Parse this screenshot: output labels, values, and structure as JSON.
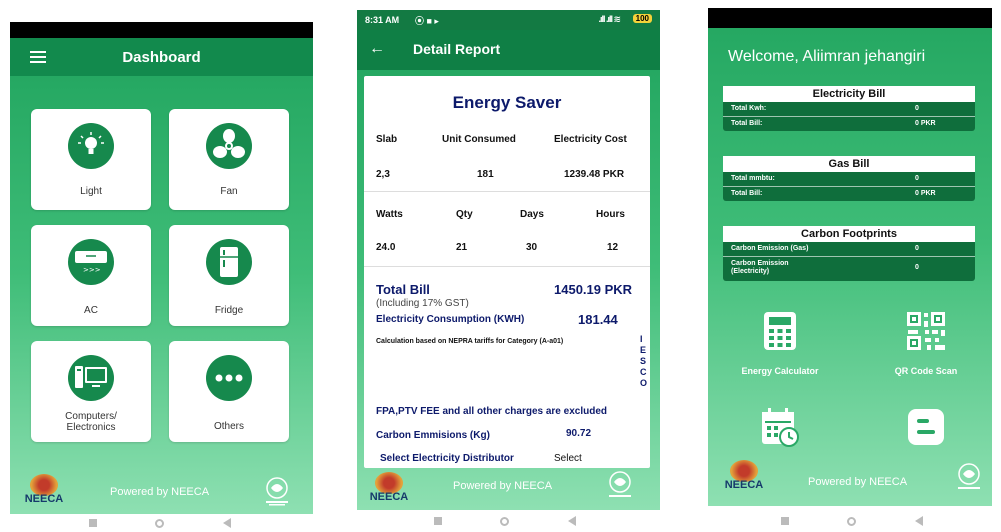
{
  "dashboard": {
    "title": "Dashboard",
    "cards": [
      {
        "label": "Light",
        "icon": "lightbulb-icon"
      },
      {
        "label": "Fan",
        "icon": "fan-icon"
      },
      {
        "label": "AC",
        "icon": "ac-icon"
      },
      {
        "label": "Fridge",
        "icon": "fridge-icon"
      },
      {
        "label": "Computers/\nElectronics",
        "icon": "computer-icon"
      },
      {
        "label": "Others",
        "icon": "more-dots-icon"
      }
    ],
    "footer": {
      "logo_text": "NEECA",
      "powered_prefix": "Powered by ",
      "powered_brand": "NEECA"
    }
  },
  "report": {
    "status_time": "8:31 AM",
    "battery": "100",
    "app_title": "Detail Report",
    "heading": "Energy Saver",
    "h1": {
      "slab": "Slab",
      "unit": "Unit Consumed",
      "cost": "Electricity Cost"
    },
    "v1": {
      "slab": "2,3",
      "unit": "181",
      "cost": "1239.48 PKR"
    },
    "h2": {
      "watts": "Watts",
      "qty": "Qty",
      "days": "Days",
      "hours": "Hours"
    },
    "v2": {
      "watts": "24.0",
      "qty": "21",
      "days": "30",
      "hours": "12"
    },
    "total_bill_label": "Total Bill",
    "total_bill_value": "1450.19 PKR",
    "gst_note": "(Including 17% GST)",
    "consumption_label": "Electricity Consumption (KWH)",
    "consumption_value": "181.44",
    "nepra_note": "Calculation based on NEPRA tariffs for Category (A-a01)",
    "iesco": [
      "I",
      "E",
      "S",
      "C",
      "O"
    ],
    "charges_note": "FPA,PTV FEE and all other charges are excluded",
    "carbon_label": "Carbon Emmisions (Kg)",
    "carbon_value": "90.72",
    "distributor_label": "Select Electricity Distributor",
    "distributor_value": "Select",
    "footer": {
      "logo_text": "NEECA",
      "powered_prefix": "Powered by ",
      "powered_brand": "NEECA"
    }
  },
  "home": {
    "welcome": "Welcome, Aliimran jehangiri",
    "electricity": {
      "title": "Electricity Bill",
      "rows": [
        {
          "k": "Total Kwh:",
          "v": "0"
        },
        {
          "k": "Total Bill:",
          "v": "0 PKR"
        }
      ]
    },
    "gas": {
      "title": "Gas Bill",
      "rows": [
        {
          "k": "Total mmbtu:",
          "v": "0"
        },
        {
          "k": "Total Bill:",
          "v": "0 PKR"
        }
      ]
    },
    "carbon": {
      "title": "Carbon Footprints",
      "rows": [
        {
          "k": "Carbon Emission (Gas)",
          "v": "0"
        },
        {
          "k": "Carbon Emission\n(Electricity)",
          "v": "0"
        }
      ]
    },
    "tools": [
      {
        "label": "Energy Calculator"
      },
      {
        "label": "QR Code Scan"
      },
      {
        "label": ""
      },
      {
        "label": ""
      }
    ],
    "footer": {
      "logo_text": "NEECA",
      "powered_prefix": "Powered by ",
      "powered_brand": "NEECA"
    }
  },
  "colors": {
    "primary": "#0f7f45",
    "accent_green": "#16894d",
    "neeca_blue": "#163a6b"
  }
}
